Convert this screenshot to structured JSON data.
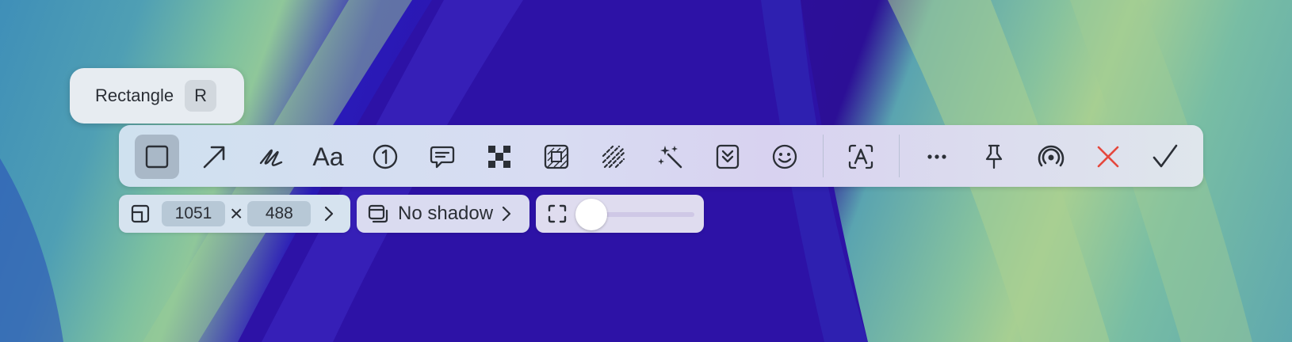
{
  "tooltip": {
    "label": "Rectangle",
    "shortcut": "R"
  },
  "toolbar": {
    "text_tool_label": "Aa",
    "tools": [
      "rectangle-tool",
      "arrow-tool",
      "pen-tool",
      "text-tool",
      "counter-tool",
      "speech-bubble-tool",
      "pixelate-tool",
      "highlight-tool",
      "hatch-tool",
      "magic-tool",
      "stack-tool",
      "emoji-tool",
      "ocr-tool",
      "more-tool",
      "pin-tool",
      "share-tool",
      "close-tool",
      "confirm-tool"
    ],
    "active_tool": "rectangle-tool"
  },
  "size": {
    "width": "1051",
    "separator": "×",
    "height": "488"
  },
  "shadow": {
    "label": "No shadow"
  },
  "padding": {
    "value": 0
  },
  "colors": {
    "close": "#e5483d",
    "active_bg": "#a9b8c7"
  }
}
